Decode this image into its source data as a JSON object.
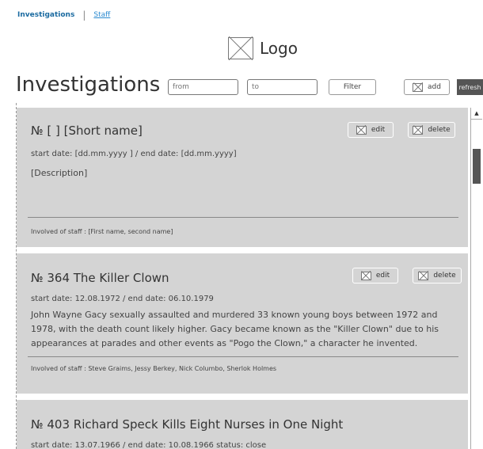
{
  "nav": {
    "active": "Investigations",
    "separator": "|",
    "staff_link": "Staff"
  },
  "logo": {
    "text": "Logo"
  },
  "page_title": "Investigations",
  "filters": {
    "from_placeholder": "from",
    "to_placeholder": "to",
    "filter_label": "Filter",
    "add_label": "add",
    "refresh_label": "refresh"
  },
  "cards": [
    {
      "title": "№ [  ]  [Short name]",
      "dates": "start date:  [dd.mm.yyyy ] / end date: [dd.mm.yyyy]",
      "description": "[Description]",
      "staff": "Involved of staff : [First name, second name]",
      "edit_label": "edit",
      "delete_label": "delete"
    },
    {
      "title": "№ 364   The Killer Clown",
      "dates": "start date: 12.08.1972 / end date: 06.10.1979",
      "description": "John Wayne Gacy sexually assaulted and murdered 33 known young boys between 1972 and 1978, with the death count likely higher. Gacy became known as the \"Killer Clown\" due to his appearances at parades and other events as \"Pogo the Clown,\" a character he invented.",
      "staff": "Involved of staff : Steve Graims, Jessy Berkey, Nick Columbo, Sherlok Holmes",
      "edit_label": "edit",
      "delete_label": "delete"
    },
    {
      "title": "№ 403   Richard Speck Kills Eight Nurses in One Night",
      "dates": "start date: 13.07.1966 / end date: 10.08.1966          status: close"
    }
  ]
}
